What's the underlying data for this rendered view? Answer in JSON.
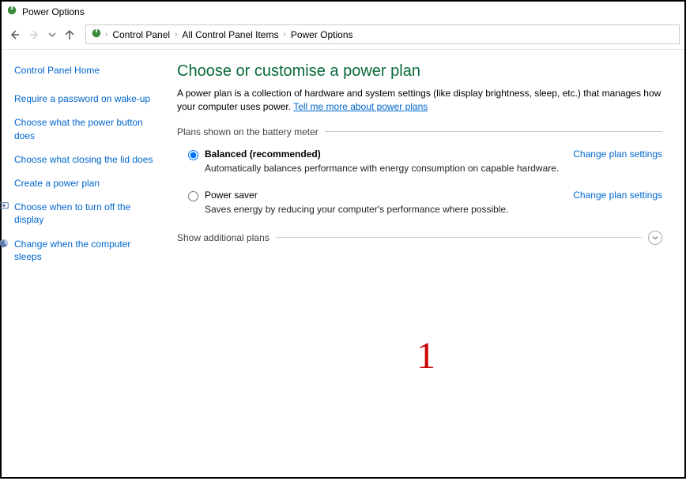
{
  "window": {
    "title": "Power Options"
  },
  "breadcrumb": {
    "items": [
      "Control Panel",
      "All Control Panel Items",
      "Power Options"
    ]
  },
  "sidebar": {
    "home": "Control Panel Home",
    "links": [
      "Require a password on wake-up",
      "Choose what the power button does",
      "Choose what closing the lid does",
      "Create a power plan",
      "Choose when to turn off the display",
      "Change when the computer sleeps"
    ]
  },
  "main": {
    "heading": "Choose or customise a power plan",
    "intro": "A power plan is a collection of hardware and system settings (like display brightness, sleep, etc.) that manages how your computer uses power. ",
    "intro_link": "Tell me more about power plans",
    "section_label": "Plans shown on the battery meter",
    "plans": [
      {
        "title": "Balanced (recommended)",
        "desc": "Automatically balances performance with energy consumption on capable hardware.",
        "link": "Change plan settings",
        "selected": true
      },
      {
        "title": "Power saver",
        "desc": "Saves energy by reducing your computer's performance where possible.",
        "link": "Change plan settings",
        "selected": false
      }
    ],
    "expander": "Show additional plans"
  },
  "overlay": {
    "number": "1"
  }
}
